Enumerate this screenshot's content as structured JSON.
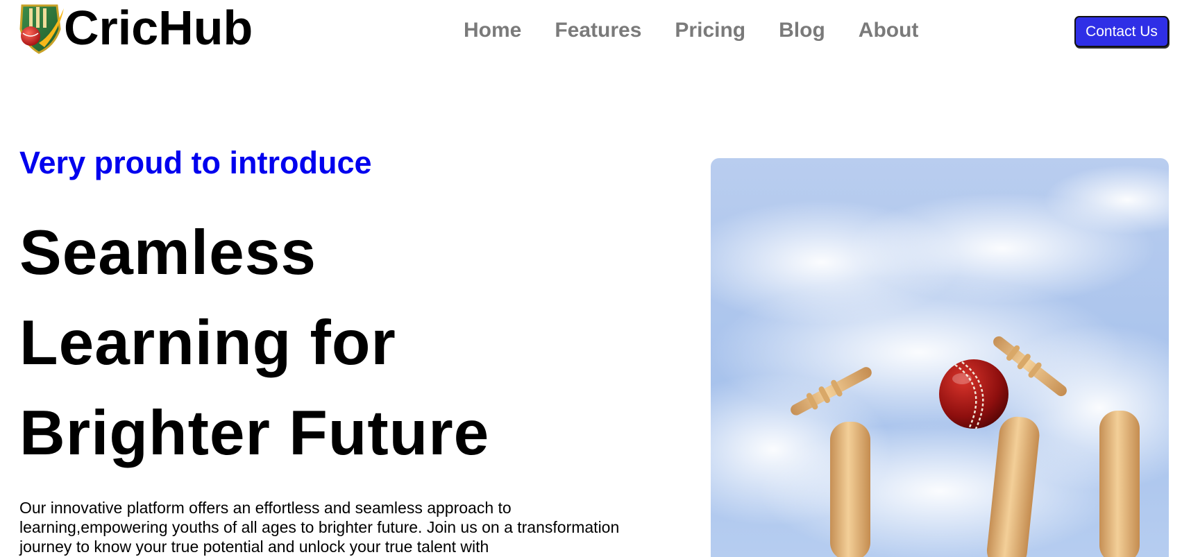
{
  "brand": {
    "name": "CricHub",
    "logo_icon": "cricket-shield-logo"
  },
  "nav": {
    "items": [
      {
        "label": "Home"
      },
      {
        "label": "Features"
      },
      {
        "label": "Pricing"
      },
      {
        "label": "Blog"
      },
      {
        "label": "About"
      }
    ],
    "contact_label": "Contact Us"
  },
  "hero": {
    "eyebrow": "Very proud to introduce",
    "headline_lines": [
      "Seamless",
      "Learning for",
      "Brighter Future"
    ],
    "description": "Our innovative platform offers an effortless and seamless approach to learning,empowering youths of all ages to brighter future. Join us on a transformation journey to know your true potential and unlock your true talent with",
    "image": "cricket-stumps-ball-sky-image"
  },
  "colors": {
    "accent_blue": "#0000ee",
    "button_bg": "#2f2fe6",
    "nav_text": "#7a7a7a"
  }
}
